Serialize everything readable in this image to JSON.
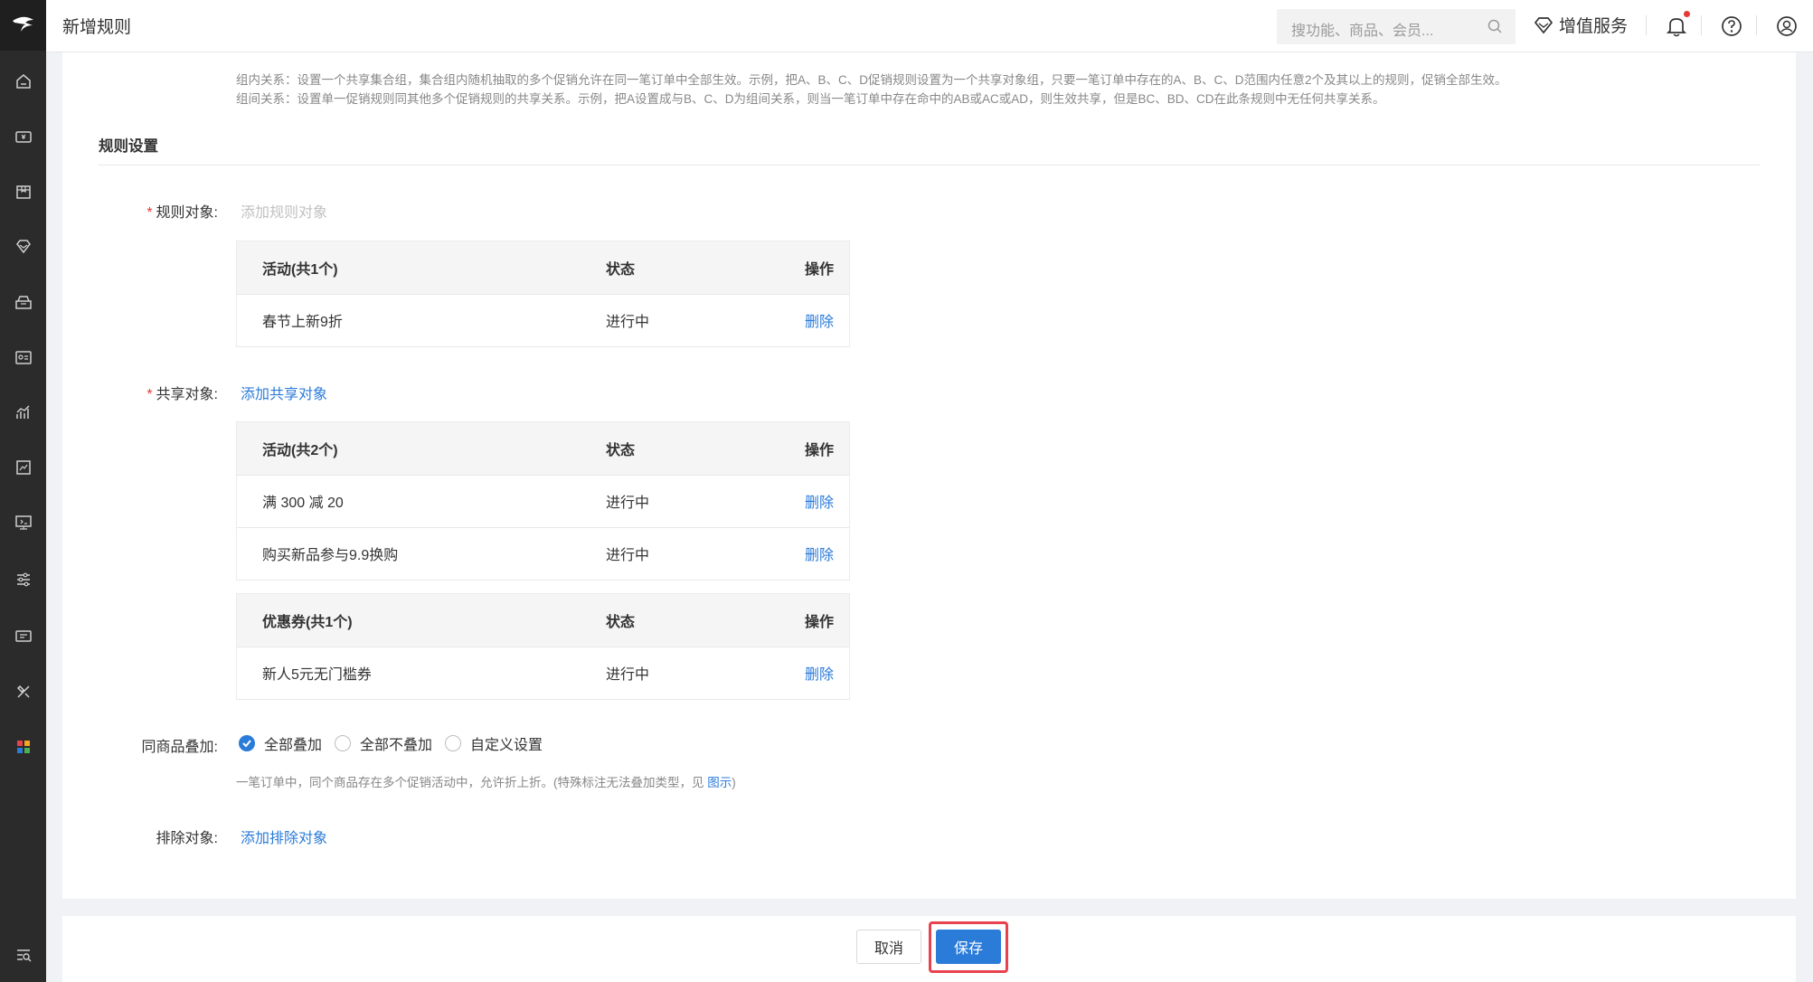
{
  "header": {
    "title": "新增规则",
    "search_placeholder": "搜功能、商品、会员...",
    "vas_label": "增值服务"
  },
  "description": {
    "line1": "组内关系：设置一个共享集合组，集合组内随机抽取的多个促销允许在同一笔订单中全部生效。示例，把A、B、C、D促销规则设置为一个共享对象组，只要一笔订单中存在的A、B、C、D范围内任意2个及其以上的规则，促销全部生效。",
    "line2": "组间关系：设置单一促销规则同其他多个促销规则的共享关系。示例，把A设置成与B、C、D为组间关系，则当一笔订单中存在命中的AB或AC或AD，则生效共享，但是BC、BD、CD在此条规则中无任何共享关系。"
  },
  "section": {
    "title": "规则设置"
  },
  "rule_object": {
    "label": "规则对象:",
    "add_text": "添加规则对象",
    "table": {
      "headers": [
        "活动(共1个)",
        "状态",
        "操作"
      ],
      "rows": [
        {
          "name": "春节上新9折",
          "status": "进行中",
          "action": "删除"
        }
      ]
    }
  },
  "share_object": {
    "label": "共享对象:",
    "add_text": "添加共享对象",
    "activity_table": {
      "headers": [
        "活动(共2个)",
        "状态",
        "操作"
      ],
      "rows": [
        {
          "name": "满 300 减 20",
          "status": "进行中",
          "action": "删除"
        },
        {
          "name": "购买新品参与9.9换购",
          "status": "进行中",
          "action": "删除"
        }
      ]
    },
    "coupon_table": {
      "headers": [
        "优惠券(共1个)",
        "状态",
        "操作"
      ],
      "rows": [
        {
          "name": "新人5元无门槛券",
          "status": "进行中",
          "action": "删除"
        }
      ]
    }
  },
  "stacking": {
    "label": "同商品叠加:",
    "options": [
      "全部叠加",
      "全部不叠加",
      "自定义设置"
    ],
    "selected": "全部叠加",
    "hint_prefix": "一笔订单中，同个商品存在多个促销活动中，允许折上折。(特殊标注无法叠加类型，见 ",
    "hint_link": "图示",
    "hint_suffix": ")"
  },
  "exclude": {
    "label": "排除对象:",
    "add_text": "添加排除对象"
  },
  "actions": {
    "cancel": "取消",
    "save": "保存"
  },
  "colors": {
    "accent": "#2b7bd9",
    "rail_bg": "#2b2b2b",
    "highlight": "#e8424e",
    "required": "#e53935"
  }
}
